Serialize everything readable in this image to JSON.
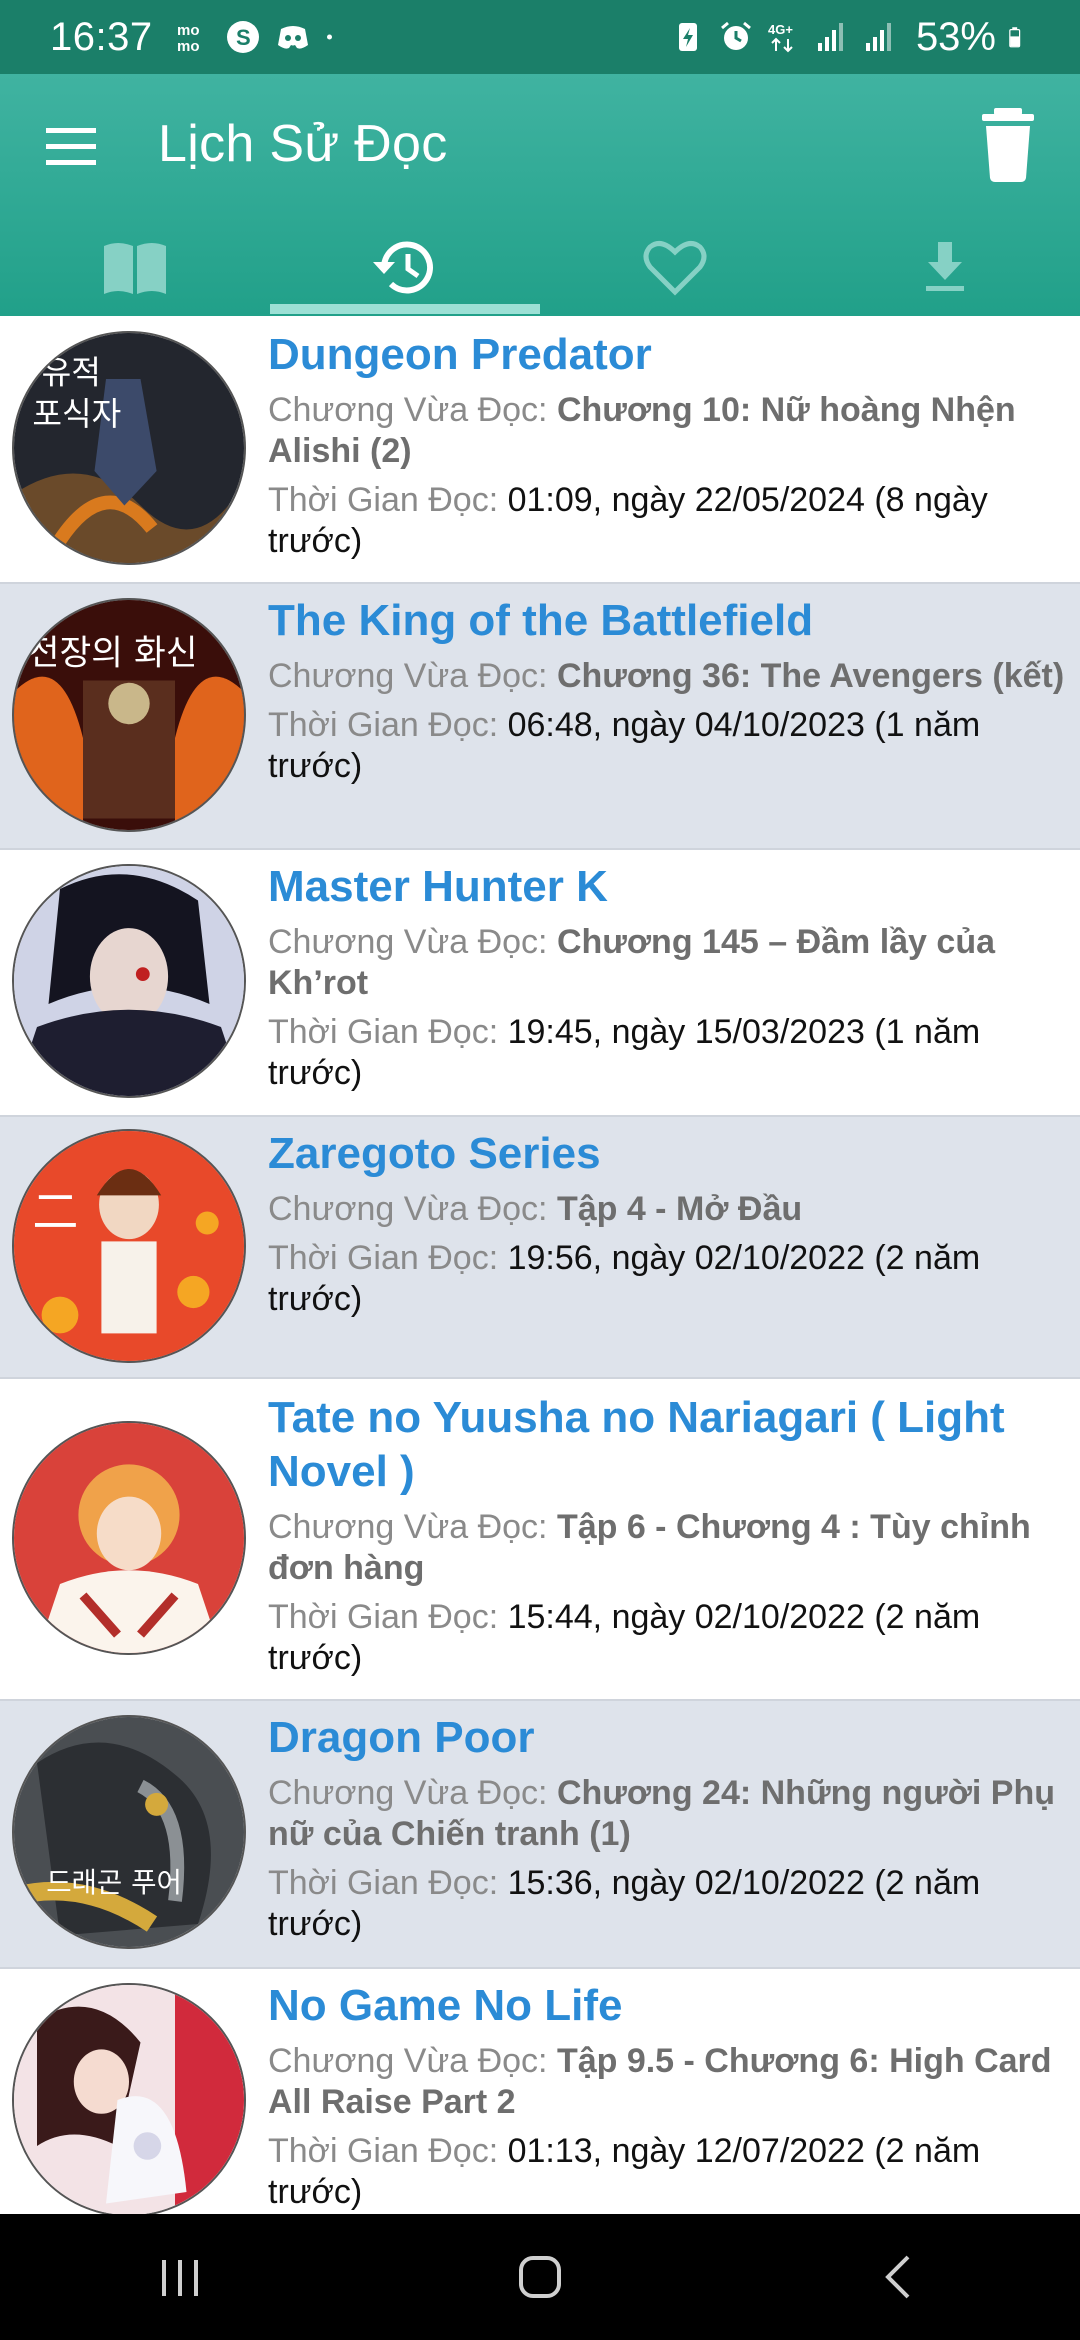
{
  "status_bar": {
    "time": "16:37",
    "battery": "53%",
    "icons": [
      "mo-mo-icon",
      "shazam-icon",
      "discord-icon",
      "dot-icon",
      "battery-saver-icon",
      "alarm-icon",
      "4g-icon",
      "signal-icon",
      "signal-icon",
      "battery-icon"
    ]
  },
  "header": {
    "title": "Lịch Sử Đọc",
    "menu_icon": "hamburger-icon",
    "delete_icon": "trash-icon",
    "tabs": [
      {
        "name": "library",
        "icon": "book-icon",
        "active": false
      },
      {
        "name": "history",
        "icon": "history-icon",
        "active": true
      },
      {
        "name": "favorites",
        "icon": "heart-icon",
        "active": false
      },
      {
        "name": "downloads",
        "icon": "download-icon",
        "active": false
      }
    ]
  },
  "labels": {
    "chapter": "Chương Vừa Đọc: ",
    "time": "Thời Gian Đọc: "
  },
  "items": [
    {
      "title": "Dungeon Predator",
      "chapter": "Chương 10: Nữ hoàng Nhện Alishi (2)",
      "time": "01:09, ngày 22/05/2024 (8 ngày trước)"
    },
    {
      "title": "The King of the Battlefield",
      "chapter": "Chương 36: The Avengers (kết)",
      "time": "06:48, ngày 04/10/2023 (1 năm trước)"
    },
    {
      "title": "Master Hunter K",
      "chapter": "Chương 145 – Đầm lầy của Kh’rot",
      "time": "19:45, ngày 15/03/2023 (1 năm trước)"
    },
    {
      "title": "Zaregoto Series",
      "chapter": "Tập 4 - Mở Đầu",
      "time": "19:56, ngày 02/10/2022 (2 năm trước)"
    },
    {
      "title": "Tate no Yuusha no Nariagari ( Light Novel )",
      "chapter": "Tập 6 - Chương 4 : Tùy chỉnh đơn hàng",
      "time": "15:44, ngày 02/10/2022 (2 năm trước)"
    },
    {
      "title": "Dragon Poor",
      "chapter": "Chương 24: Những người Phụ nữ của Chiến tranh (1)",
      "time": "15:36, ngày 02/10/2022 (2 năm trước)"
    },
    {
      "title": "No Game No Life",
      "chapter": "Tập 9.5 - Chương 6: High Card All Raise Part 2",
      "time": "01:13, ngày 12/07/2022 (2 năm trước)"
    }
  ],
  "nav": {
    "buttons": [
      "recent-apps-icon",
      "home-icon",
      "back-icon"
    ]
  },
  "colors": {
    "status_bar": "#1b7f69",
    "app_bar": "#2aa890",
    "title_link": "#2b8bd6",
    "alt_row": "#dee3eb"
  }
}
